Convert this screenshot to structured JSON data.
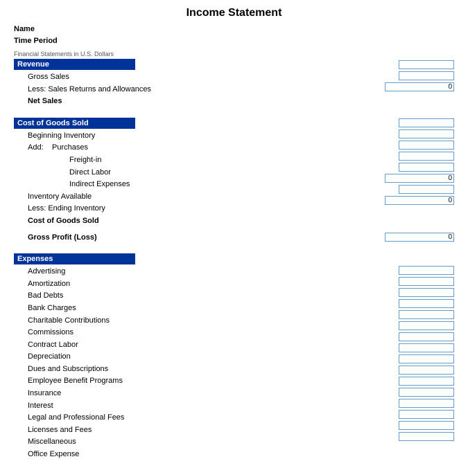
{
  "page": {
    "title": "Income Statement",
    "meta": {
      "name_label": "Name",
      "time_period_label": "Time Period",
      "financial_note": "Financial Statements in U.S. Dollars"
    },
    "sections": {
      "revenue": {
        "header": "Revenue",
        "items": [
          {
            "label": "Gross Sales",
            "indent": 1
          },
          {
            "label": "Less: Sales Returns and Allowances",
            "indent": 1
          },
          {
            "label": "Net Sales",
            "indent": 1,
            "bold": true
          }
        ],
        "totals": {
          "net_sales": "0"
        }
      },
      "cogs": {
        "header": "Cost of Goods Sold",
        "items": [
          {
            "label": "Beginning Inventory",
            "indent": 1
          },
          {
            "label": "Add:",
            "indent": 1,
            "sub_items": [
              "Purchases",
              "Freight-in",
              "Direct Labor",
              "Indirect Expenses"
            ]
          },
          {
            "label": "Inventory Available",
            "indent": 1
          },
          {
            "label": "Less: Ending Inventory",
            "indent": 1
          },
          {
            "label": "Cost of Goods Sold",
            "indent": 1,
            "bold": true
          }
        ],
        "totals": {
          "inventory_available": "0",
          "cogs": "0"
        }
      },
      "gross_profit": {
        "label": "Gross Profit (Loss)",
        "bold": true,
        "value": "0"
      },
      "expenses": {
        "header": "Expenses",
        "items": [
          "Advertising",
          "Amortization",
          "Bad Debts",
          "Bank Charges",
          "Charitable Contributions",
          "Commissions",
          "Contract Labor",
          "Depreciation",
          "Dues and Subscriptions",
          "Employee Benefit Programs",
          "Insurance",
          "Interest",
          "Legal and Professional Fees",
          "Licenses and Fees",
          "Miscellaneous",
          "Office Expense"
        ]
      }
    }
  }
}
